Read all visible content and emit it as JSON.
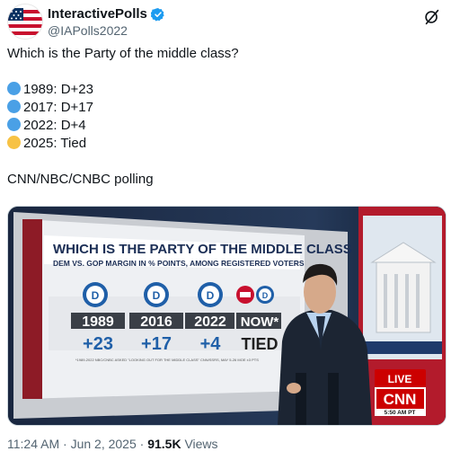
{
  "author": {
    "name": "InteractivePolls",
    "handle": "@IAPolls2022",
    "verified": true
  },
  "tweet": {
    "question": "Which is the Party of the middle class?",
    "items": [
      {
        "text": "1989: D+23",
        "dot_color": "#4aa0e6"
      },
      {
        "text": "2017: D+17",
        "dot_color": "#4aa0e6"
      },
      {
        "text": "2022: D+4",
        "dot_color": "#4aa0e6"
      },
      {
        "text": "2025: Tied",
        "dot_color": "#f7c244"
      }
    ],
    "source": "CNN/NBC/CNBC polling"
  },
  "media": {
    "board_title": "WHICH IS THE PARTY OF THE MIDDLE CLASS",
    "board_subtitle": "DEM VS. GOP MARGIN IN % POINTS, AMONG REGISTERED VOTERS",
    "columns": [
      {
        "year": "1989",
        "value": "+23"
      },
      {
        "year": "2016",
        "value": "+17"
      },
      {
        "year": "2022",
        "value": "+4"
      },
      {
        "year": "NOW*",
        "value": "TIED"
      }
    ],
    "footnote": "*1989-2022 NBC/CNBC ASKED \"LOOKING OUT FOR THE MIDDLE CLASS\" CNN/SSRS, MAY 5-26 MOE ±3 PTS",
    "live_label": "LIVE",
    "network": "CNN",
    "time": "5:50 AM PT"
  },
  "meta": {
    "time": "11:24 AM",
    "separator": "·",
    "date": "Jun 2, 2025",
    "views_count": "91.5K",
    "views_label": "Views"
  }
}
